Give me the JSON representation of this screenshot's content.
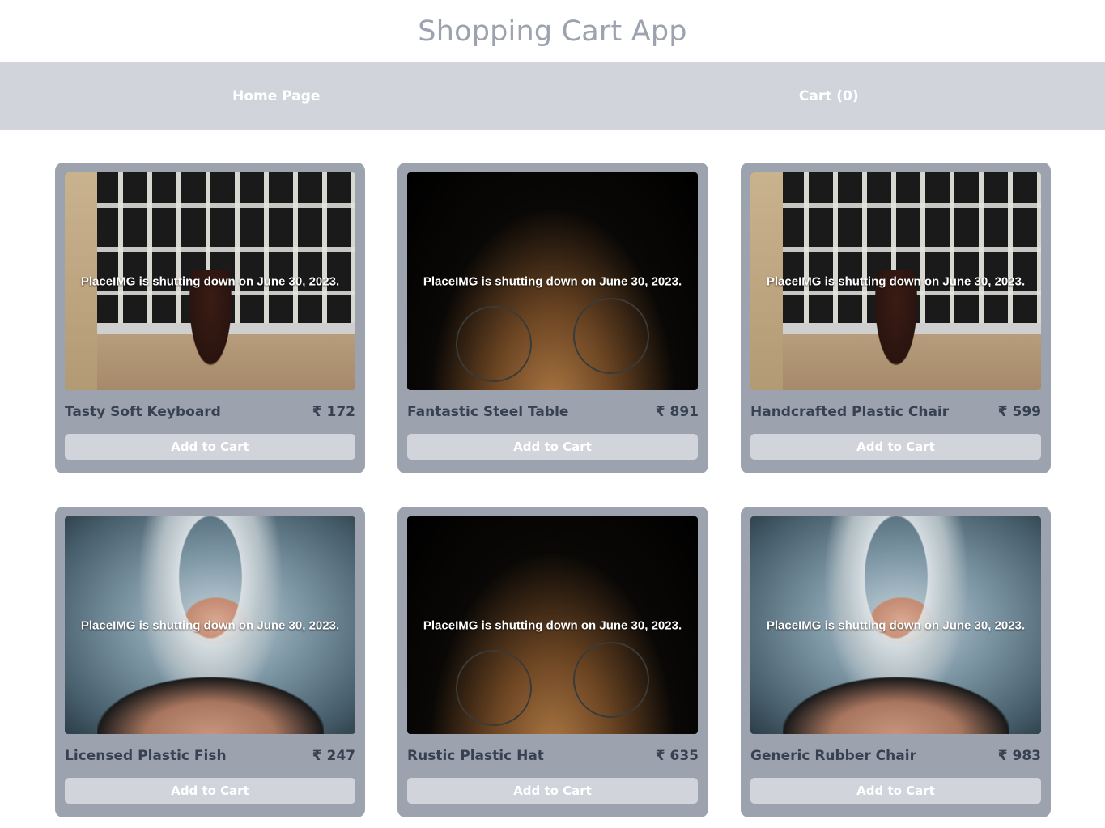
{
  "header": {
    "title": "Shopping Cart App"
  },
  "nav": {
    "home_label": "Home Page",
    "cart_label": "Cart (0)"
  },
  "image_caption": "PlaceIMG is shutting down on June 30, 2023.",
  "products": [
    {
      "name": "Tasty Soft Keyboard",
      "price": "₹ 172",
      "image": "window-photo",
      "button": "Add to Cart"
    },
    {
      "name": "Fantastic Steel Table",
      "price": "₹ 891",
      "image": "bicycle-photo",
      "button": "Add to Cart"
    },
    {
      "name": "Handcrafted Plastic Chair",
      "price": "₹ 599",
      "image": "window-photo",
      "button": "Add to Cart"
    },
    {
      "name": "Licensed Plastic Fish",
      "price": "₹ 247",
      "image": "portrait-photo",
      "button": "Add to Cart"
    },
    {
      "name": "Rustic Plastic Hat",
      "price": "₹ 635",
      "image": "bicycle-photo",
      "button": "Add to Cart"
    },
    {
      "name": "Generic Rubber Chair",
      "price": "₹ 983",
      "image": "portrait-photo",
      "button": "Add to Cart"
    }
  ],
  "colors": {
    "title": "#9ca3af",
    "navbar": "#d1d5db",
    "card": "#9ca3af",
    "button": "#d1d5db",
    "text": "#374151"
  }
}
